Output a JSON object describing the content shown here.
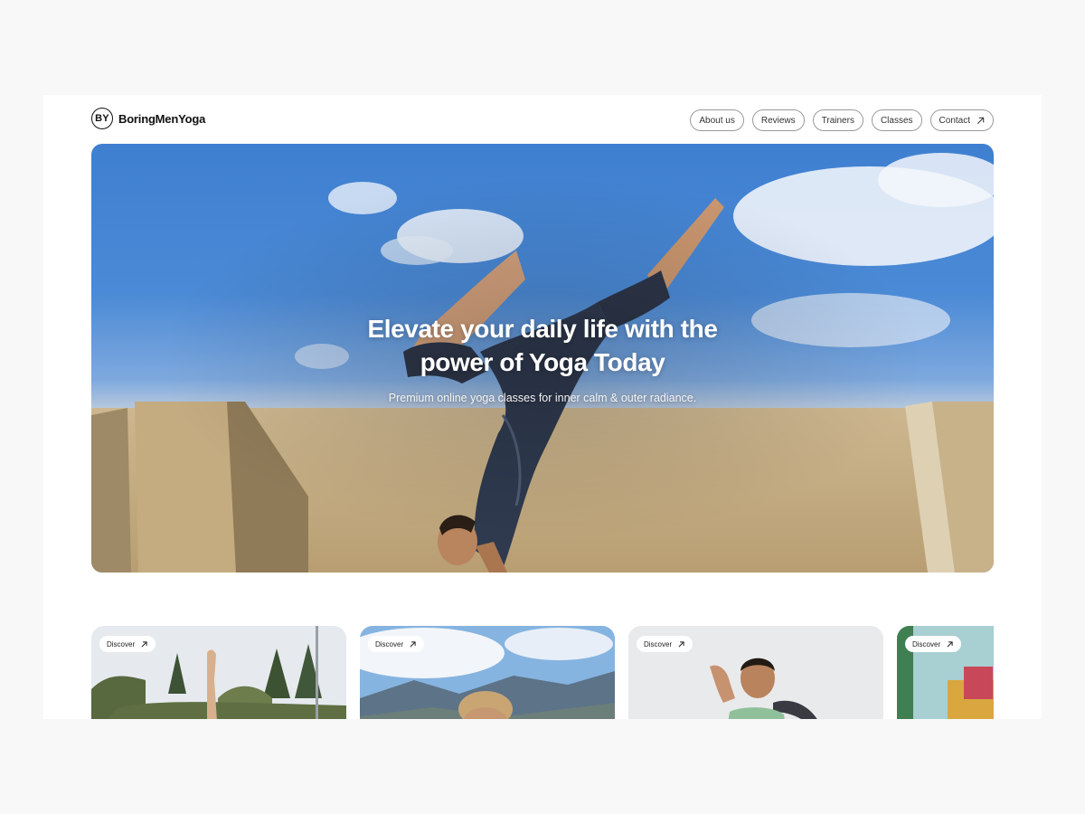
{
  "header": {
    "logo_mark": "BY",
    "logo_text": "BoringMenYoga",
    "nav": [
      {
        "label": "About us"
      },
      {
        "label": "Reviews"
      },
      {
        "label": "Trainers"
      },
      {
        "label": "Classes"
      },
      {
        "label": "Contact",
        "icon": "arrow-up-right-icon"
      }
    ]
  },
  "hero": {
    "title_line1": "Elevate your daily life with the",
    "title_line2": "power of Yoga Today",
    "subtitle": "Premium online yoga classes for inner calm & outer radiance."
  },
  "cards": [
    {
      "label": "Discover",
      "icon": "arrow-up-right-icon"
    },
    {
      "label": "Discover",
      "icon": "arrow-up-right-icon"
    },
    {
      "label": "Discover",
      "icon": "arrow-up-right-icon"
    },
    {
      "label": "Discover",
      "icon": "arrow-up-right-icon"
    }
  ]
}
